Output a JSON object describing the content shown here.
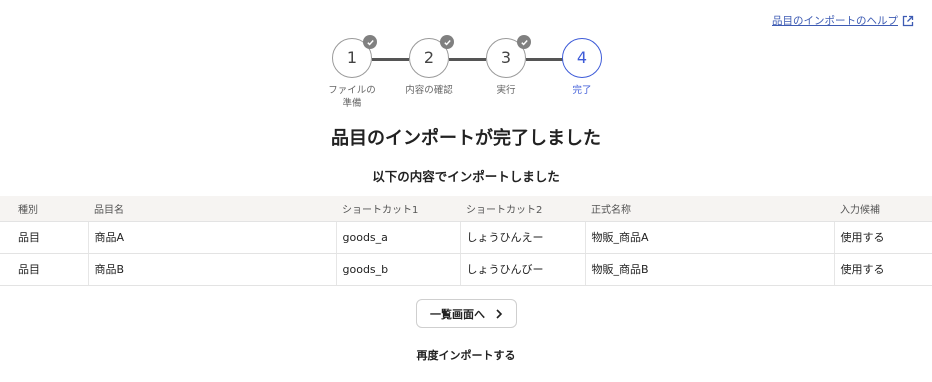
{
  "help_link": {
    "label": "品目のインポートのヘルプ",
    "icon": "external-link-icon"
  },
  "stepper": {
    "steps": [
      {
        "number": "1",
        "label_line1": "ファイルの",
        "label_line2": "準備",
        "status": "done"
      },
      {
        "number": "2",
        "label_line1": "内容の確認",
        "label_line2": "",
        "status": "done"
      },
      {
        "number": "3",
        "label_line1": "実行",
        "label_line2": "",
        "status": "done"
      },
      {
        "number": "4",
        "label_line1": "完了",
        "label_line2": "",
        "status": "active"
      }
    ],
    "active_color": "#3d5bd8",
    "done_check_color": "#808080"
  },
  "title": "品目のインポートが完了しました",
  "subtitle": "以下の内容でインポートしました",
  "table": {
    "headers": [
      "種別",
      "品目名",
      "ショートカット1",
      "ショートカット2",
      "正式名称",
      "入力候補"
    ],
    "rows": [
      [
        "品目",
        "商品A",
        "goods_a",
        "しょうひんえー",
        "物販_商品A",
        "使用する"
      ],
      [
        "品目",
        "商品B",
        "goods_b",
        "しょうひんびー",
        "物販_商品B",
        "使用する"
      ]
    ]
  },
  "list_button": {
    "label": "一覧画面へ",
    "icon": "chevron-right-icon"
  },
  "reimport_link": {
    "label": "再度インポートする"
  }
}
